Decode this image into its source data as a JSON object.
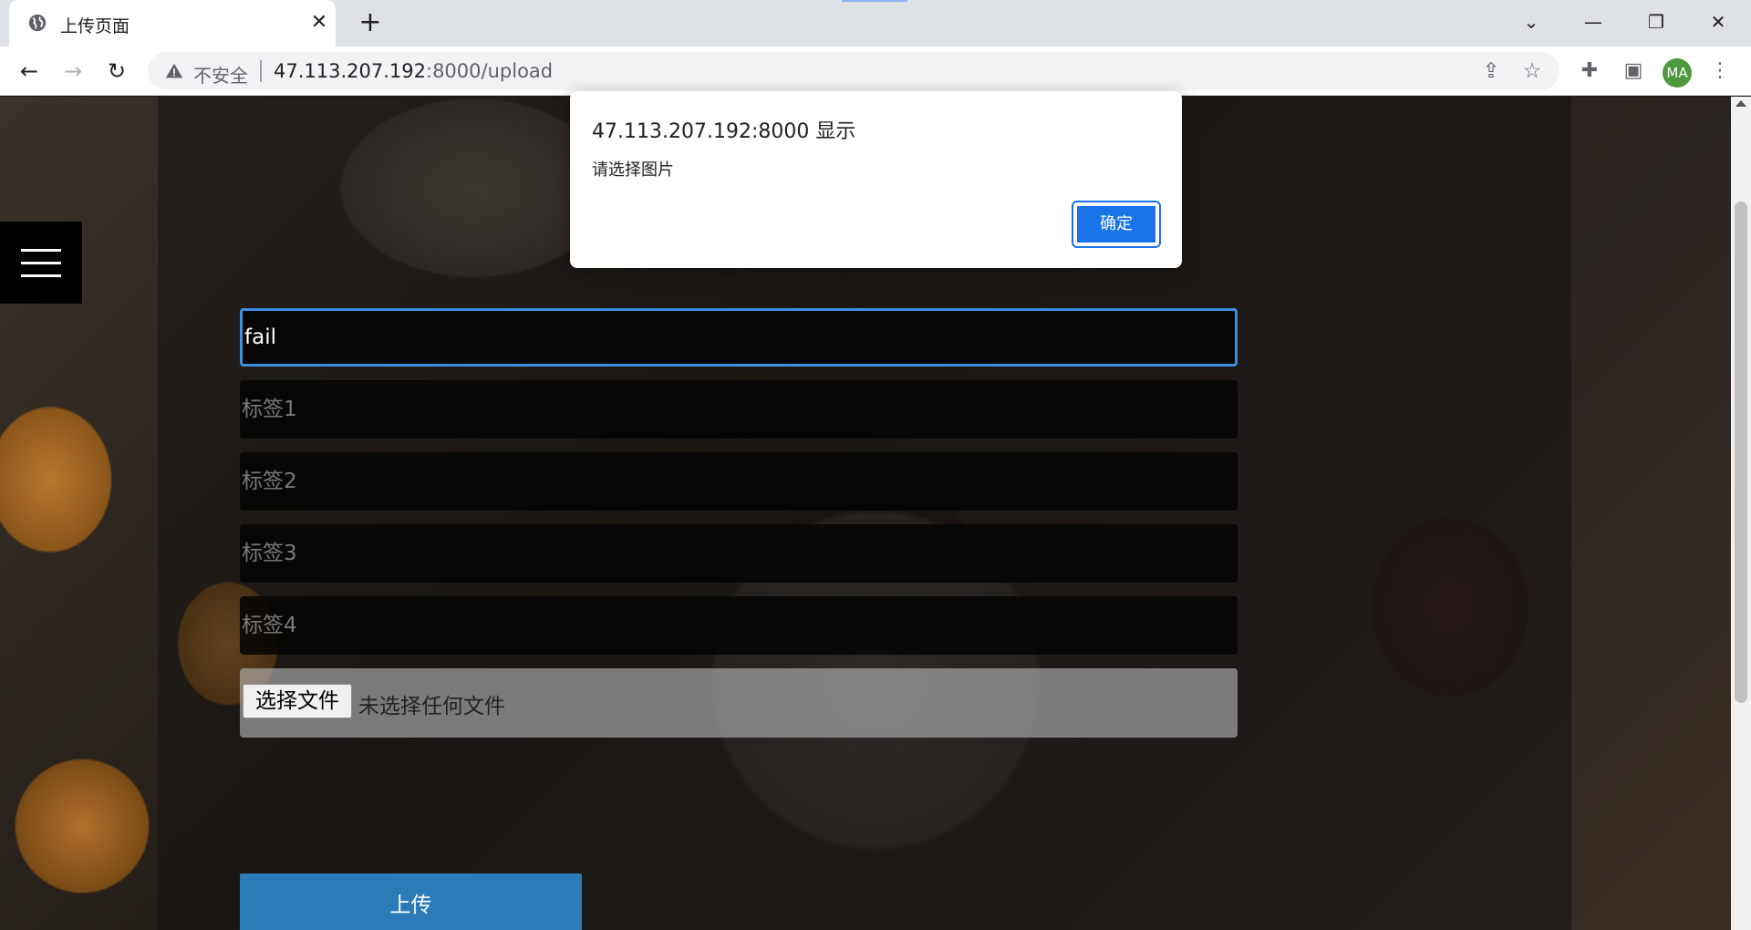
{
  "browser": {
    "tab_title": "上传页面",
    "tab_close": "✕",
    "new_tab": "+",
    "window_controls": {
      "dropdown": "⌄",
      "minimize": "—",
      "restore": "❐",
      "close": "✕"
    },
    "nav": {
      "back": "←",
      "forward": "→",
      "reload": "↻"
    },
    "omnibox": {
      "security_label": "不安全",
      "url_host": "47.113.207.192",
      "url_rest": ":8000/upload"
    },
    "profile_initials": "MA"
  },
  "page": {
    "title_field_value": "fail",
    "tag_placeholders": [
      "标签1",
      "标签2",
      "标签3",
      "标签4"
    ],
    "file_button_label": "选择文件",
    "file_status": "未选择任何文件",
    "upload_button_label": "上传"
  },
  "dialog": {
    "title": "47.113.207.192:8000 显示",
    "message": "请选择图片",
    "ok_label": "确定"
  }
}
